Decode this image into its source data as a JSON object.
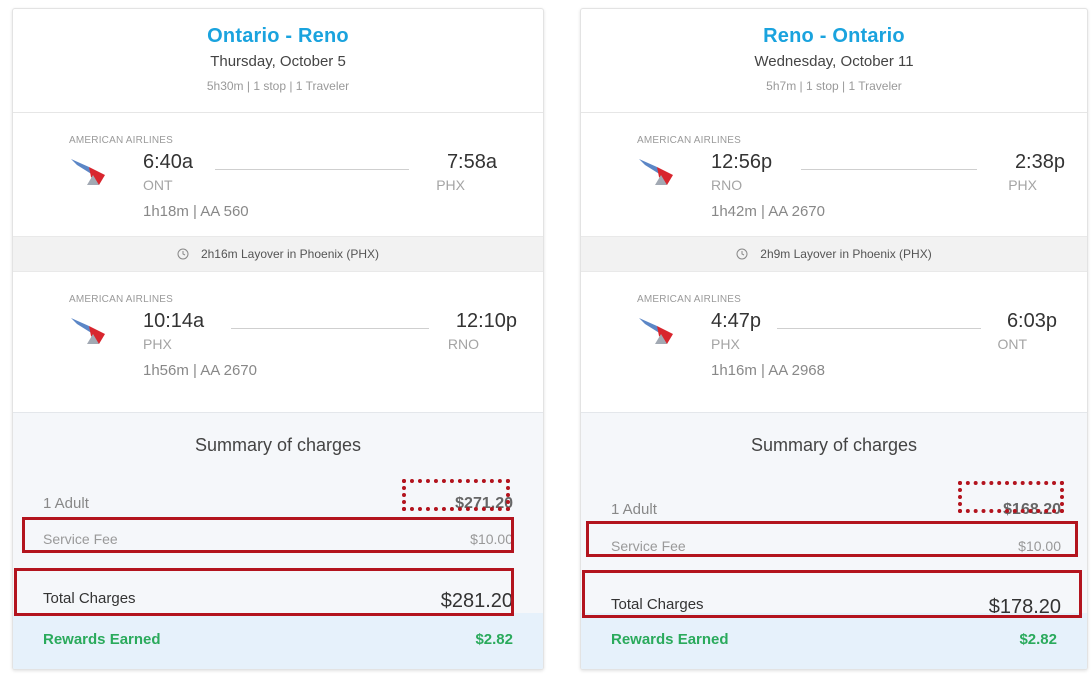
{
  "colors": {
    "route_blue": "#1aa3de",
    "rewards_green": "#2aaa5c",
    "highlight_red": "#b3141e"
  },
  "trips": [
    {
      "route": "Ontario - Reno",
      "date": "Thursday, October 5",
      "meta": "5h30m | 1 stop | 1 Traveler",
      "segments": [
        {
          "airline": "AMERICAN AIRLINES",
          "dep_time": "6:40a",
          "dep_code": "ONT",
          "arr_time": "7:58a",
          "arr_code": "PHX",
          "details": "1h18m | AA 560"
        },
        {
          "airline": "AMERICAN AIRLINES",
          "dep_time": "10:14a",
          "dep_code": "PHX",
          "arr_time": "12:10p",
          "arr_code": "RNO",
          "details": "1h56m | AA 2670"
        }
      ],
      "layover": "2h16m Layover in Phoenix (PHX)",
      "summary": {
        "title": "Summary of charges",
        "adult_label": "1 Adult",
        "adult_value": "$271.20",
        "fee_label": "Service Fee",
        "fee_value": "$10.00",
        "total_label": "Total Charges",
        "total_value": "$281.20",
        "rewards_label": "Rewards Earned",
        "rewards_value": "$2.82"
      }
    },
    {
      "route": "Reno - Ontario",
      "date": "Wednesday, October 11",
      "meta": "5h7m | 1 stop | 1 Traveler",
      "segments": [
        {
          "airline": "AMERICAN AIRLINES",
          "dep_time": "12:56p",
          "dep_code": "RNO",
          "arr_time": "2:38p",
          "arr_code": "PHX",
          "details": "1h42m | AA 2670"
        },
        {
          "airline": "AMERICAN AIRLINES",
          "dep_time": "4:47p",
          "dep_code": "PHX",
          "arr_time": "6:03p",
          "arr_code": "ONT",
          "details": "1h16m | AA 2968"
        }
      ],
      "layover": "2h9m Layover in Phoenix (PHX)",
      "summary": {
        "title": "Summary of charges",
        "adult_label": "1 Adult",
        "adult_value": "$168.20",
        "fee_label": "Service Fee",
        "fee_value": "$10.00",
        "total_label": "Total Charges",
        "total_value": "$178.20",
        "rewards_label": "Rewards Earned",
        "rewards_value": "$2.82"
      }
    }
  ]
}
